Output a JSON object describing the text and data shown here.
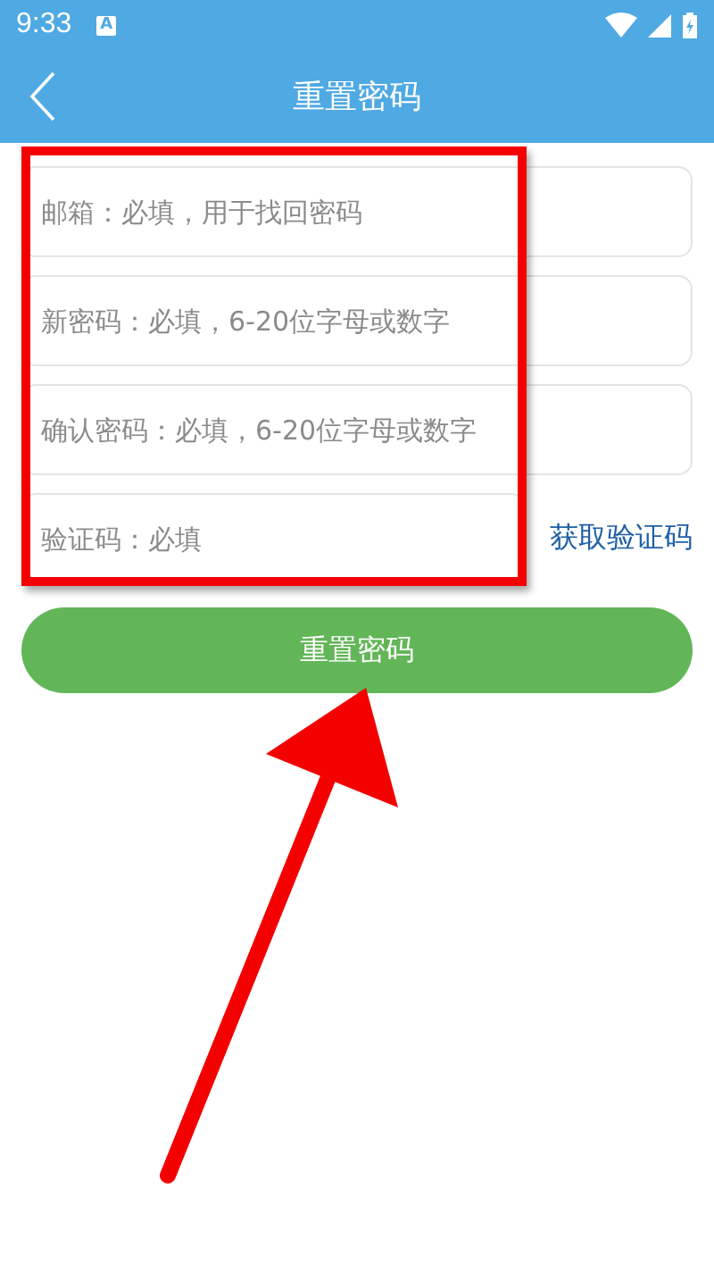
{
  "status_bar": {
    "time": "9:33",
    "notification": "A"
  },
  "header": {
    "title": "重置密码"
  },
  "fields": [
    {
      "kind": "email",
      "placeholder": "邮箱：必填，用于找回密码"
    },
    {
      "kind": "password",
      "placeholder": "新密码：必填，6-20位字母或数字"
    },
    {
      "kind": "password",
      "placeholder": "确认密码：必填，6-20位字母或数字"
    },
    {
      "kind": "code",
      "placeholder": "验证码：必填",
      "action": "获取验证码"
    }
  ],
  "submit": {
    "label": "重置密码"
  }
}
